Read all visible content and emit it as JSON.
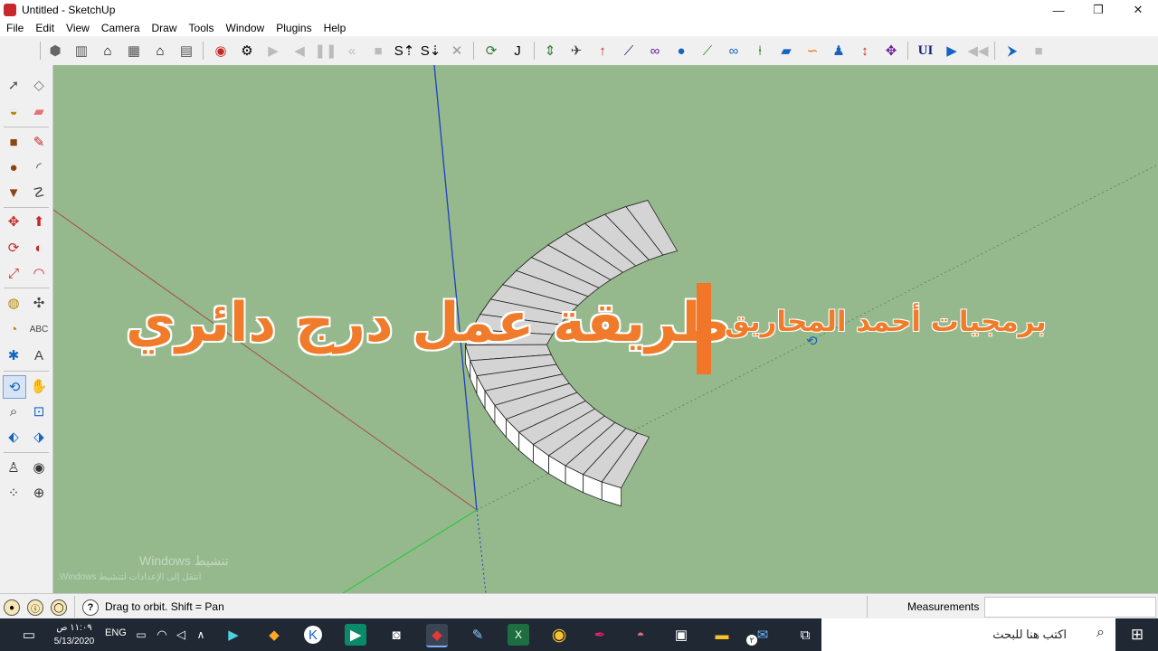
{
  "window": {
    "title": "Untitled - SketchUp",
    "minimize_glyph": "—",
    "restore_glyph": "❐",
    "close_glyph": "✕"
  },
  "menu": [
    "File",
    "Edit",
    "View",
    "Camera",
    "Draw",
    "Tools",
    "Window",
    "Plugins",
    "Help"
  ],
  "toolbar": {
    "icons": [
      "iso-view-icon",
      "front-view-icon",
      "home-view-icon",
      "right-view-icon",
      "top-view-icon",
      "back-view-icon",
      "record-icon",
      "walk-camera-icon",
      "play-icon",
      "step-back-icon",
      "pause-icon",
      "rewind-icon",
      "stop-icon",
      "s-up-icon",
      "s-down-icon",
      "close-x-icon",
      "rotate-cycle-icon",
      "curve-j-icon",
      "move-vertical-icon",
      "plane-icon",
      "arrow-up-icon",
      "line-tool-icon",
      "link-icon",
      "sphere-icon",
      "draw-line-icon",
      "loop-icon",
      "pin-icon",
      "flat-icon",
      "curl-icon",
      "figure-icon",
      "double-arrow-icon",
      "gear-move-icon",
      "ui-icon",
      "forward-icon",
      "fast-back-icon",
      "cursor-flag-icon",
      "stop-square-icon"
    ],
    "ui_label": "UI"
  },
  "left_tools": [
    "select-icon",
    "eraser-shape-icon",
    "paint-bucket-icon",
    "eraser-icon",
    "rectangle-icon",
    "pencil-icon",
    "circle-icon",
    "arc-icon",
    "polygon-icon",
    "freehand-icon",
    "move-icon",
    "push-pull-icon",
    "rotate-icon",
    "follow-me-icon",
    "scale-icon",
    "offset-icon",
    "tape-measure-icon",
    "dimension-icon",
    "protractor-icon",
    "text-icon",
    "axes-icon",
    "3d-text-icon",
    "orbit-icon",
    "pan-icon",
    "zoom-icon",
    "zoom-window-icon",
    "zoom-extents-icon",
    "previous-icon",
    "position-camera-icon",
    "look-around-icon",
    "walk-icon",
    "section-icon"
  ],
  "overlay": {
    "main_title": "طريقة عمل درج دائري",
    "subtitle": "برمجيات أحمد المحاريق",
    "watermark_line1": "تنشيط Windows",
    "watermark_line2": "انتقل إلى الإعدادات لتنشيط Windows."
  },
  "status": {
    "hint": "Drag to orbit.  Shift = Pan",
    "measurements_label": "Measurements",
    "help_glyph": "?"
  },
  "taskbar": {
    "time": "١١:٠٩ ص",
    "date": "5/13/2020",
    "lang": "ENG",
    "search_placeholder": "اكتب هنا للبحث",
    "notification_badge": "٢"
  },
  "colors": {
    "viewport": "#95b98d",
    "title_orange": "#f07b2a",
    "accent_bar": "#f2762a",
    "taskbar": "#202833",
    "axis_blue": "#1f3fbf",
    "axis_red": "#a84b3f",
    "axis_green": "#2fc63c"
  }
}
